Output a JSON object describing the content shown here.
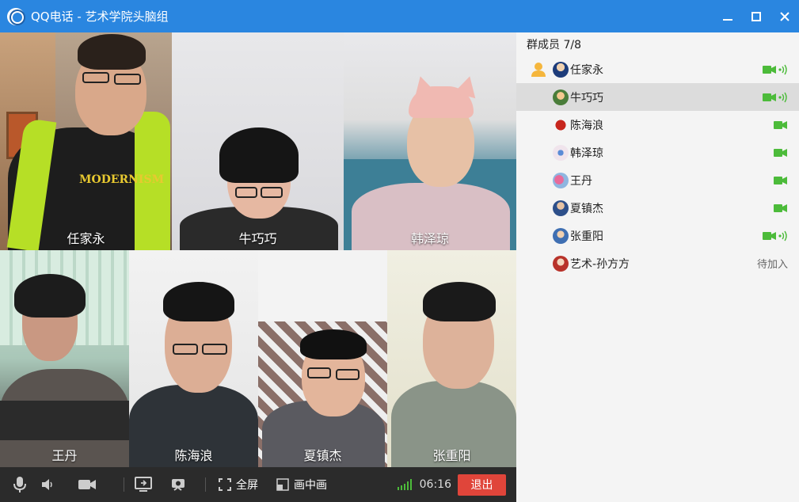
{
  "window": {
    "title": "QQ电话 - 艺术学院头脑组",
    "minimize_icon": "minimize-icon",
    "maximize_icon": "maximize-icon",
    "close_icon": "close-icon"
  },
  "videos": [
    {
      "name": "任家永"
    },
    {
      "name": "牛巧巧"
    },
    {
      "name": "韩泽琼"
    },
    {
      "name": "王丹"
    },
    {
      "name": "陈海浪"
    },
    {
      "name": "夏镇杰"
    },
    {
      "name": "张重阳"
    }
  ],
  "toolbar": {
    "mic_icon": "microphone-icon",
    "speaker_icon": "speaker-icon",
    "camera_icon": "camera-icon",
    "screen_share_icon": "screen-share-icon",
    "switch_camera_icon": "switch-camera-icon",
    "fullscreen_label": "全屏",
    "pip_label": "画中画",
    "signal_icon": "signal-icon",
    "timer": "06:16",
    "exit_label": "退出"
  },
  "panel": {
    "header": "群成员 7/8",
    "members": [
      {
        "name": "任家永",
        "status": "camera-speaking",
        "host": true
      },
      {
        "name": "牛巧巧",
        "status": "camera-speaking",
        "selected": true
      },
      {
        "name": "陈海浪",
        "status": "camera"
      },
      {
        "name": "韩泽琼",
        "status": "camera"
      },
      {
        "name": "王丹",
        "status": "camera"
      },
      {
        "name": "夏镇杰",
        "status": "camera"
      },
      {
        "name": "张重阳",
        "status": "camera-speaking"
      },
      {
        "name": "艺术-孙方方",
        "status": "pending",
        "pending_label": "待加入"
      }
    ]
  },
  "colors": {
    "titlebar": "#2a86e0",
    "exit": "#e0453a",
    "status_green": "#4cbb3a"
  }
}
